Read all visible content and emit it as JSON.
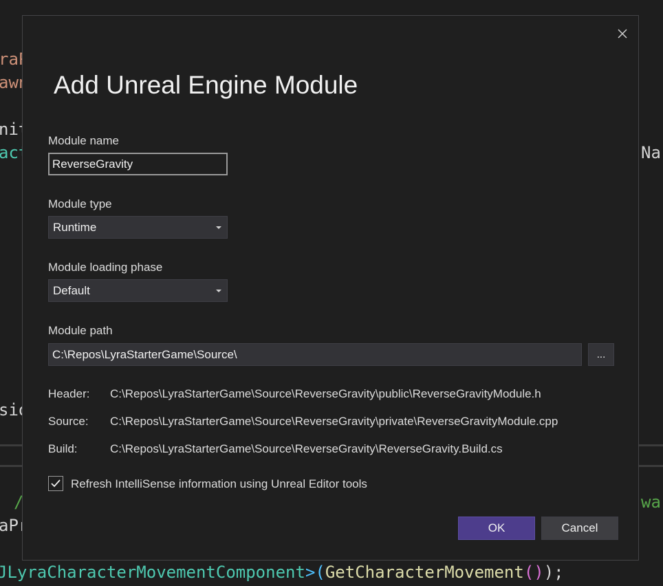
{
  "background_code": {
    "frag1": "raP",
    "frag2": "awn",
    "frag3": "nit",
    "frag4": "act",
    "frag5": "Nar",
    "frag6": "sio",
    "frag7": "/",
    "frag8": "war",
    "frag9": "aPr",
    "frag10a": "JLyraCharacterMovementComponent",
    "frag10b": ">(",
    "frag10c": "GetCharacterMovement",
    "frag10d": "()",
    "frag10e": ");"
  },
  "dialog": {
    "title": "Add Unreal Engine Module",
    "module_name": {
      "label": "Module name",
      "value": "ReverseGravity"
    },
    "module_type": {
      "label": "Module type",
      "selected": "Runtime"
    },
    "loading_phase": {
      "label": "Module loading phase",
      "selected": "Default"
    },
    "module_path": {
      "label": "Module path",
      "value": "C:\\Repos\\LyraStarterGame\\Source\\",
      "browse_label": "..."
    },
    "files": [
      {
        "label": "Header:",
        "path": "C:\\Repos\\LyraStarterGame\\Source\\ReverseGravity\\public\\ReverseGravityModule.h"
      },
      {
        "label": "Source:",
        "path": "C:\\Repos\\LyraStarterGame\\Source\\ReverseGravity\\private\\ReverseGravityModule.cpp"
      },
      {
        "label": "Build:",
        "path": "C:\\Repos\\LyraStarterGame\\Source\\ReverseGravity\\ReverseGravity.Build.cs"
      }
    ],
    "refresh_intellisense": {
      "label": "Refresh IntelliSense information using Unreal Editor tools",
      "checked": true
    },
    "ok_label": "OK",
    "cancel_label": "Cancel"
  },
  "colors": {
    "dialog_bg": "#1f1f1f",
    "primary_button": "#4d3d8c",
    "editor_bg": "#1e1e1e"
  }
}
